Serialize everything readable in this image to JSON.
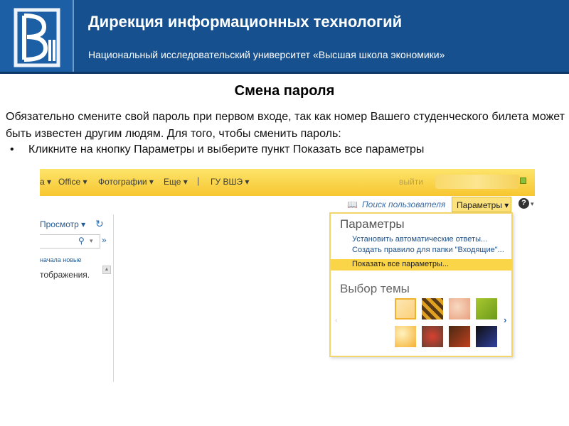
{
  "header": {
    "title": "Дирекция информационных технологий",
    "subtitle": "Национальный исследовательский университет «Высшая школа экономики»",
    "logo_icon": "hse-logo-icon",
    "colors": {
      "band": "#17508f",
      "logo_bg": "#1c5fa5"
    }
  },
  "main": {
    "title": "Смена пароля",
    "intro": "Обязательно смените свой пароль при первом входе, так как номер Вашего студенческого билета может быть известен другим людям. Для того, чтобы сменить пароль:",
    "bullet_symbol": "•",
    "bullet": "Кликните на кнопку Параметры и выберите пункт Показать все параметры"
  },
  "screenshot": {
    "topbar": {
      "items": [
        "а ▾",
        "Office ▾",
        "Фотографии ▾",
        "Еще ▾",
        "|",
        "ГУ ВШЭ ▾"
      ],
      "signout": "выйти",
      "accent": "#f7c630"
    },
    "left_pane": {
      "view": "Просмотр ▾",
      "refresh_icon": "↻",
      "search_icon": "⚲",
      "dropdown_icon": "▾",
      "collapse_icon": "»",
      "newest": "начала новые",
      "message": "тображения.",
      "scroll_icon": "▲"
    },
    "toolbar": {
      "search_users": "Поиск пользователя",
      "address_book_icon": "📖",
      "params_button": "Параметры ▾",
      "help_icon": "?",
      "help_dropdown": "▾"
    },
    "menu": {
      "heading": "Параметры",
      "items": [
        "Установить автоматические ответы...",
        "Создать правило для папки \"Входящие\"..."
      ],
      "highlighted": "Показать все параметры...",
      "theme_heading": "Выбор темы",
      "arrow_left": "‹",
      "arrow_right": "›"
    }
  }
}
